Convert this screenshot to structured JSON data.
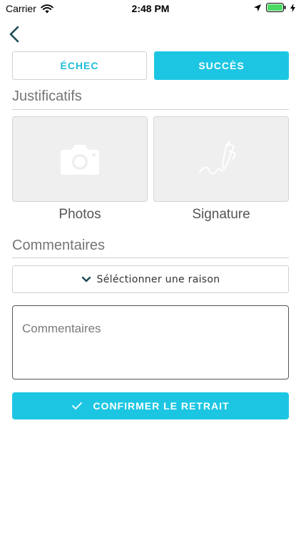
{
  "status_bar": {
    "carrier": "Carrier",
    "time": "2:48 PM",
    "icons": [
      "wifi-icon",
      "location-arrow-icon",
      "battery-icon",
      "charging-bolt-icon"
    ]
  },
  "nav": {
    "back_icon": "chevron-left-icon"
  },
  "segmented": {
    "echec_label": "ÉCHEC",
    "succes_label": "SUCCÈS",
    "selected": "SUCCÈS"
  },
  "justificatifs": {
    "title": "Justificatifs",
    "tiles": [
      {
        "label": "Photos",
        "icon": "camera-icon"
      },
      {
        "label": "Signature",
        "icon": "signature-pen-icon"
      }
    ]
  },
  "commentaires": {
    "title": "Commentaires",
    "reason_select": "Séléctionner une raison",
    "textarea_placeholder": "Commentaires"
  },
  "confirm": {
    "label": "CONFIRMER LE RETRAIT",
    "icon": "check-icon"
  },
  "colors": {
    "accent": "#1cc6e3",
    "tile_bg": "#efefef",
    "battery": "#4cd964"
  }
}
